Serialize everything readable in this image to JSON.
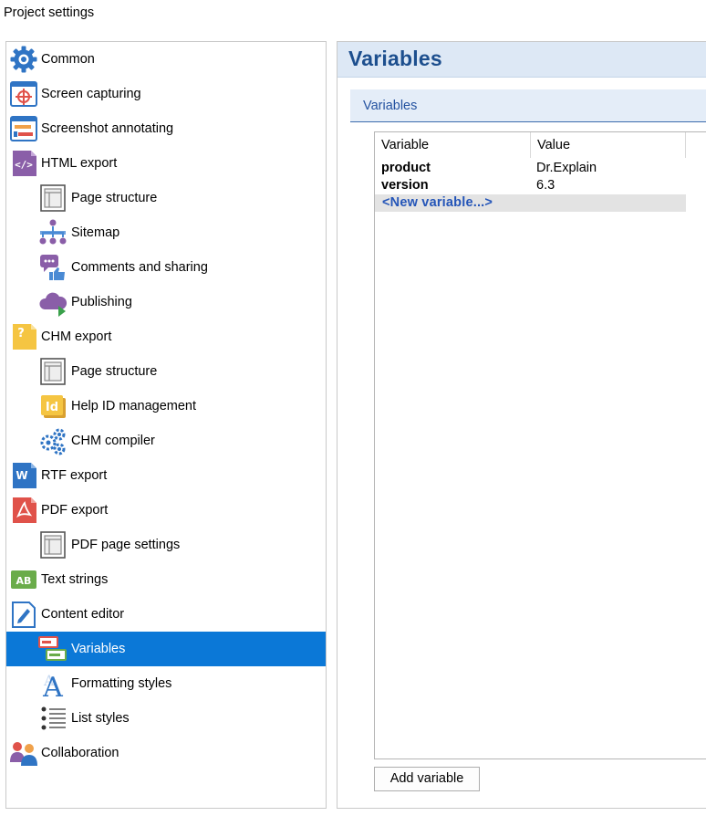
{
  "window": {
    "title": "Project settings"
  },
  "tree": {
    "items": [
      {
        "label": "Common",
        "level": 1,
        "icon": "gear-icon"
      },
      {
        "label": "Screen capturing",
        "level": 1,
        "icon": "screen-capture-icon"
      },
      {
        "label": "Screenshot annotating",
        "level": 1,
        "icon": "annotate-icon"
      },
      {
        "label": "HTML export",
        "level": 1,
        "icon": "html-export-icon"
      },
      {
        "label": "Page structure",
        "level": 2,
        "icon": "page-structure-icon"
      },
      {
        "label": "Sitemap",
        "level": 2,
        "icon": "sitemap-icon"
      },
      {
        "label": "Comments and sharing",
        "level": 2,
        "icon": "comments-icon"
      },
      {
        "label": "Publishing",
        "level": 2,
        "icon": "cloud-publish-icon"
      },
      {
        "label": "CHM export",
        "level": 1,
        "icon": "chm-export-icon"
      },
      {
        "label": "Page structure",
        "level": 2,
        "icon": "page-structure-icon"
      },
      {
        "label": "Help ID management",
        "level": 2,
        "icon": "help-id-icon"
      },
      {
        "label": "CHM compiler",
        "level": 2,
        "icon": "gears-icon"
      },
      {
        "label": "RTF export",
        "level": 1,
        "icon": "rtf-export-icon"
      },
      {
        "label": "PDF export",
        "level": 1,
        "icon": "pdf-export-icon"
      },
      {
        "label": "PDF page settings",
        "level": 2,
        "icon": "page-structure-icon"
      },
      {
        "label": "Text strings",
        "level": 1,
        "icon": "text-strings-icon"
      },
      {
        "label": "Content editor",
        "level": 1,
        "icon": "content-editor-icon"
      },
      {
        "label": "Variables",
        "level": 2,
        "icon": "variables-icon",
        "selected": true
      },
      {
        "label": "Formatting styles",
        "level": 2,
        "icon": "formatting-styles-icon"
      },
      {
        "label": "List styles",
        "level": 2,
        "icon": "list-styles-icon"
      },
      {
        "label": "Collaboration",
        "level": 1,
        "icon": "collaboration-icon"
      }
    ]
  },
  "content": {
    "title": "Variables",
    "section_title": "Variables",
    "table": {
      "columns": [
        "Variable",
        "Value"
      ],
      "rows": [
        {
          "variable": "product",
          "value": "Dr.Explain"
        },
        {
          "variable": "version",
          "value": "6.3"
        }
      ],
      "new_row_label": "<New variable...>"
    },
    "add_button_label": "Add variable"
  },
  "colors": {
    "selection": "#0b78d7",
    "header_bg": "#dde8f5",
    "header_text": "#1d4f8e",
    "section_text": "#2452a0",
    "new_variable_text": "#2455b8"
  }
}
